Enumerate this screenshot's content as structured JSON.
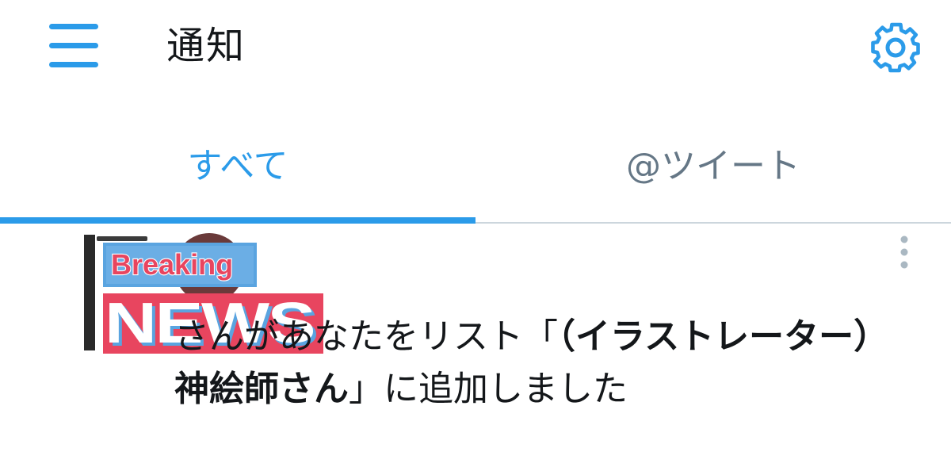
{
  "header": {
    "title": "通知",
    "menu_icon": "hamburger-menu-icon",
    "settings_icon": "gear-icon"
  },
  "tabs": [
    {
      "label": "すべて",
      "active": true
    },
    {
      "label": "@ツイート",
      "active": false
    }
  ],
  "notification": {
    "overlay": {
      "line1": "Breaking",
      "line2": "NEWS"
    },
    "text_pre": "さんがあなたをリスト「",
    "list_name": "（イラストレーター）神絵師さん",
    "text_post": "」に追加しました",
    "more_icon": "vertical-dots-icon"
  },
  "colors": {
    "accent": "#2b9be9",
    "text": "#14171a",
    "muted": "#657786",
    "divider": "#ccd6dd",
    "news_red": "#e8455f",
    "news_blue": "#5aa4e0"
  }
}
